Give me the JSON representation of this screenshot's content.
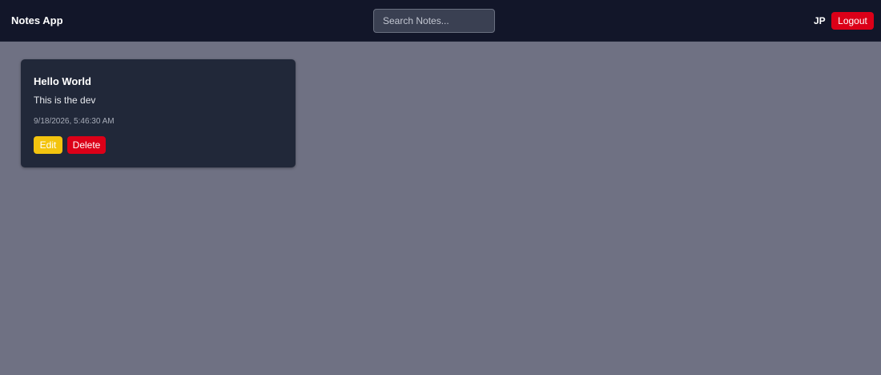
{
  "header": {
    "brand": "Notes App",
    "search_placeholder": "Search Notes...",
    "user_initials": "JP",
    "logout_label": "Logout"
  },
  "notes": [
    {
      "title": "Hello World",
      "body": "This is the dev",
      "date": "9/18/2026, 5:46:30 AM",
      "edit_label": "Edit",
      "delete_label": "Delete"
    }
  ],
  "colors": {
    "page_bg": "#6f7183",
    "navbar_bg": "#121629",
    "card_bg": "#212839",
    "edit_button": "#f3c40f",
    "danger_button": "#dc0018"
  }
}
